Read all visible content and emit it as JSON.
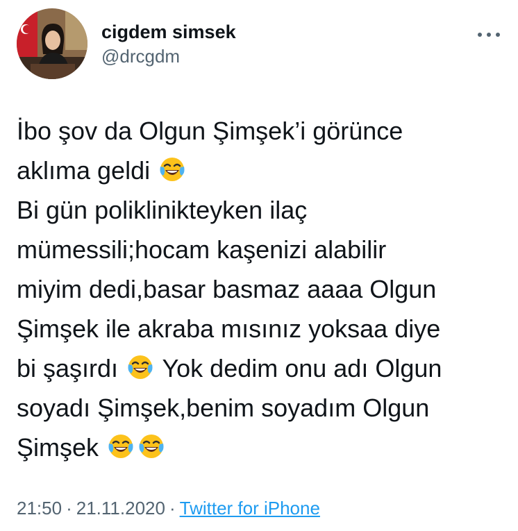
{
  "author": {
    "display_name": "cigdem simsek",
    "handle": "@drcgdm"
  },
  "actions": {
    "more_icon": "more-horizontal-icon"
  },
  "tweet": {
    "lines": [
      "İbo şov da Olgun Şimşek’i görünce",
      "aklıma geldi",
      "Bi gün poliklinikteyken ilaç",
      "mümessili;hocam kaşenizi alabilir",
      "miyim dedi,basar basmaz aaaa Olgun",
      "Şimşek ile akraba mısınız yoksaa diye",
      "bi şaşırdı",
      "Yok dedim onu adı Olgun",
      "soyadı Şimşek,benim soyadım Olgun",
      "Şimşek"
    ],
    "emoji_icon": "face-with-tears-of-joy-icon"
  },
  "meta": {
    "time": "21:50",
    "separator": "·",
    "date": "21.11.2020",
    "source": "Twitter for iPhone"
  },
  "colors": {
    "text": "#0f1419",
    "secondary": "#536471",
    "link": "#1d9bf0"
  }
}
